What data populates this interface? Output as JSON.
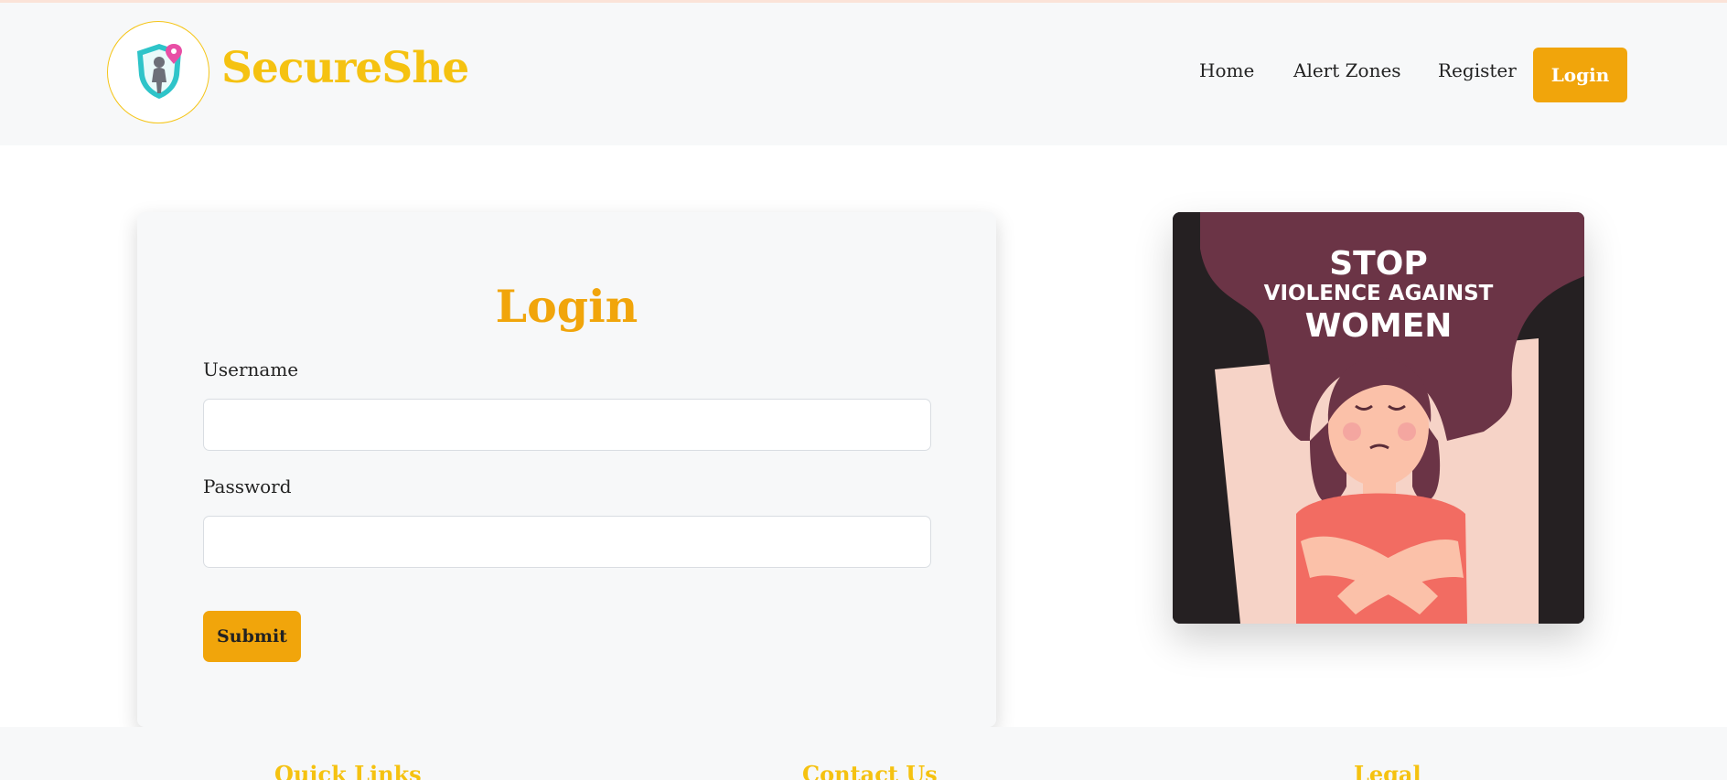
{
  "header": {
    "brand": "SecureShe",
    "nav": [
      "Home",
      "Alert Zones",
      "Register"
    ],
    "login_button": "Login",
    "logo_icon": "shield-person-location-icon"
  },
  "login_card": {
    "title": "Login",
    "username_label": "Username",
    "username_value": "",
    "password_label": "Password",
    "password_value": "",
    "submit_label": "Submit"
  },
  "poster": {
    "line1": "STOP",
    "line2": "VIOLENCE AGAINST",
    "line3": "WOMEN"
  },
  "footer": {
    "headings": [
      "Quick Links",
      "Contact Us",
      "Legal"
    ]
  },
  "colors": {
    "accent": "#f1a50b",
    "brand": "#f5c211",
    "header_bg": "#f7f8f9"
  }
}
